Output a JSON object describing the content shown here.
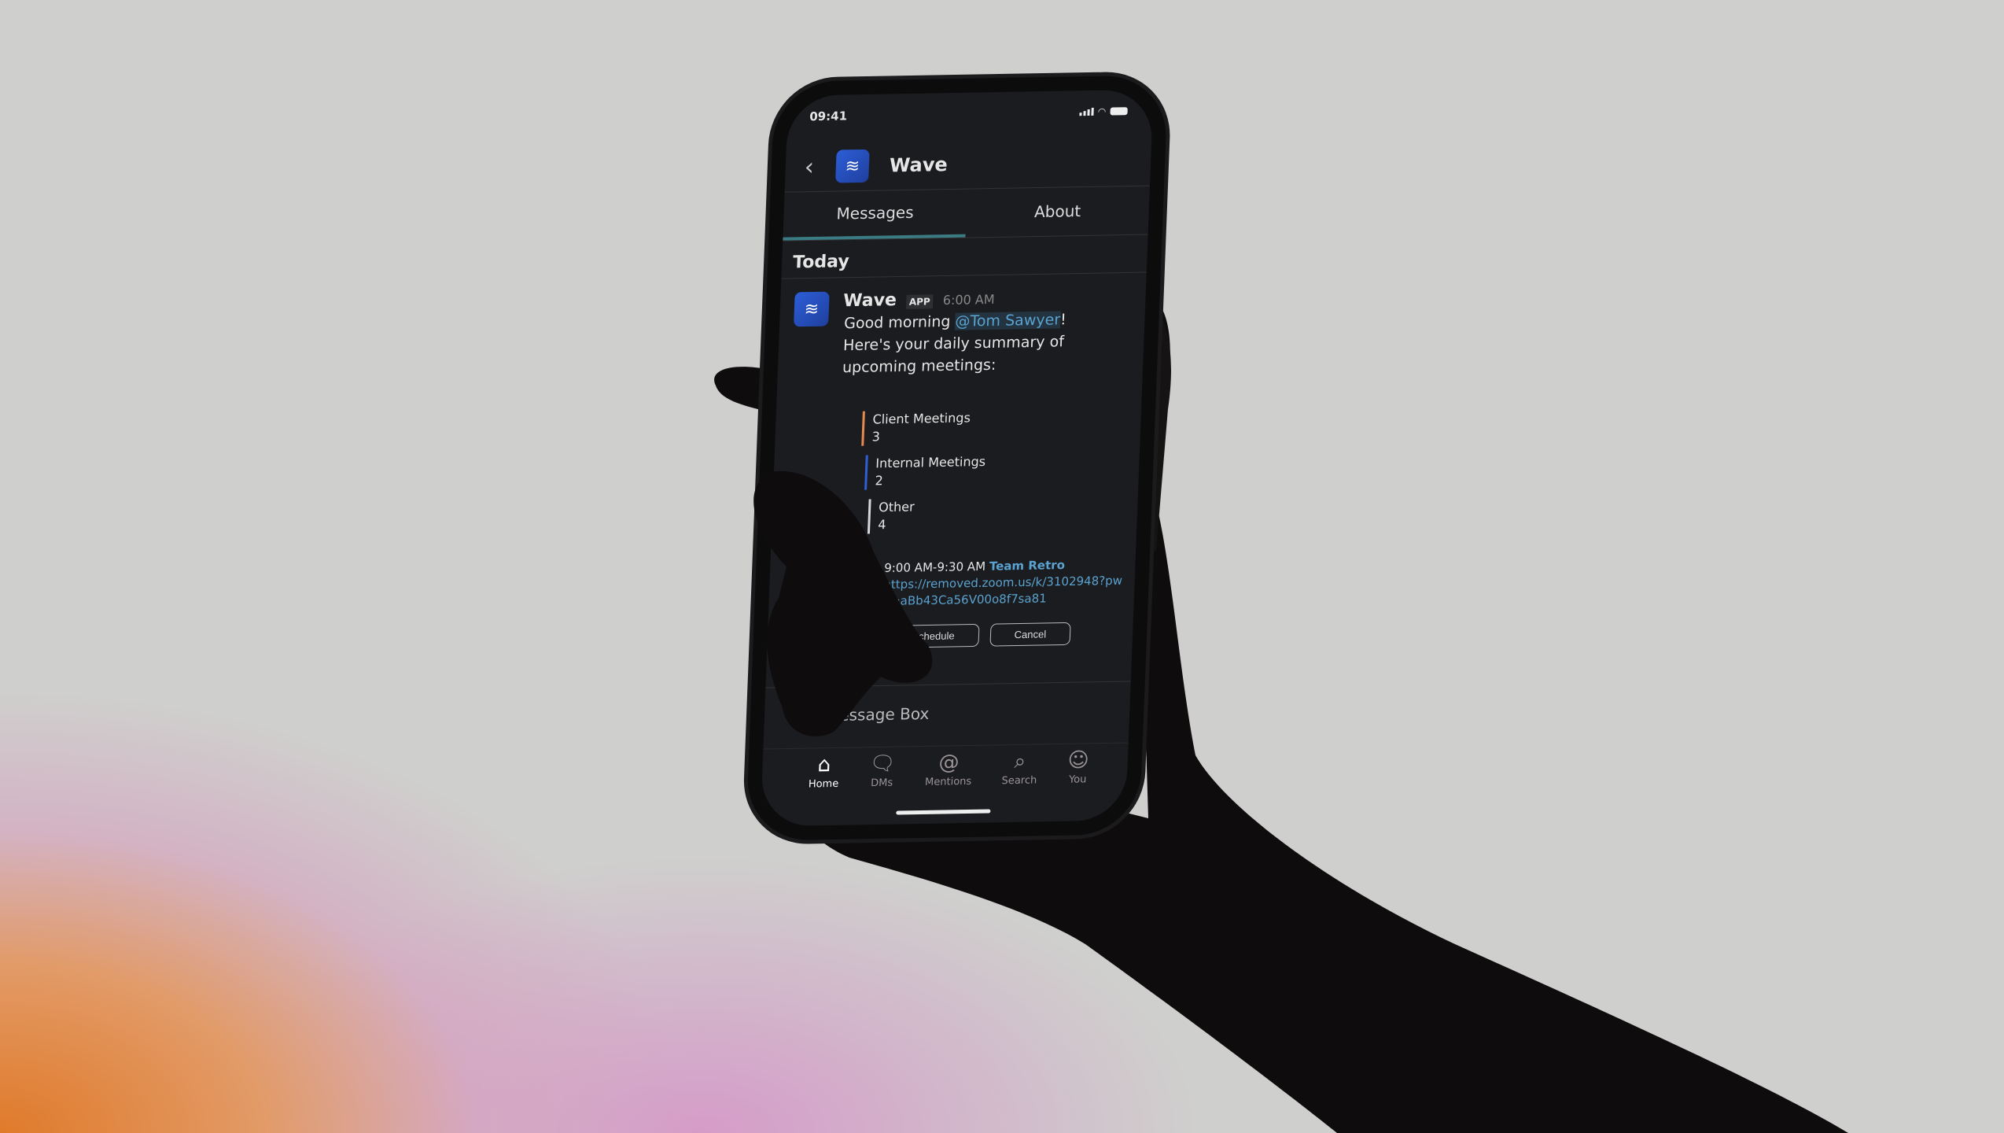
{
  "status": {
    "time": "09:41"
  },
  "header": {
    "back_icon": "chevron-left-icon",
    "logo_icon": "wave-logo-icon",
    "title": "Wave"
  },
  "tabs": [
    {
      "label": "Messages",
      "active": true
    },
    {
      "label": "About",
      "active": false
    }
  ],
  "section": "Today",
  "message": {
    "sender": "Wave",
    "badge": "APP",
    "time": "6:00 AM",
    "greeting": "Good morning ",
    "mention": "@Tom Sawyer",
    "greeting_end": "!",
    "body": "Here's your daily summary of upcoming meetings:",
    "stats": [
      {
        "label": "Client Meetings",
        "value": "3",
        "color": "#e58b4f"
      },
      {
        "label": "Internal Meetings",
        "value": "2",
        "color": "#2f5fd4"
      },
      {
        "label": "Other",
        "value": "4",
        "color": "#d8d8d8"
      }
    ],
    "event": {
      "time": "9:00 AM-9:30 AM",
      "title": "Team Retro",
      "link": "https://removed.zoom.us/k/3102948?pwd=aBb43Ca56V00o8f7sa81"
    },
    "buttons": {
      "reschedule": "Reschedule",
      "cancel": "Cancel"
    }
  },
  "composer": {
    "placeholder": "Message Box"
  },
  "nav": [
    {
      "label": "Home",
      "icon": "home-icon",
      "active": true
    },
    {
      "label": "DMs",
      "icon": "dms-icon"
    },
    {
      "label": "Mentions",
      "icon": "at-icon"
    },
    {
      "label": "Search",
      "icon": "search-icon"
    },
    {
      "label": "You",
      "icon": "you-icon"
    }
  ]
}
